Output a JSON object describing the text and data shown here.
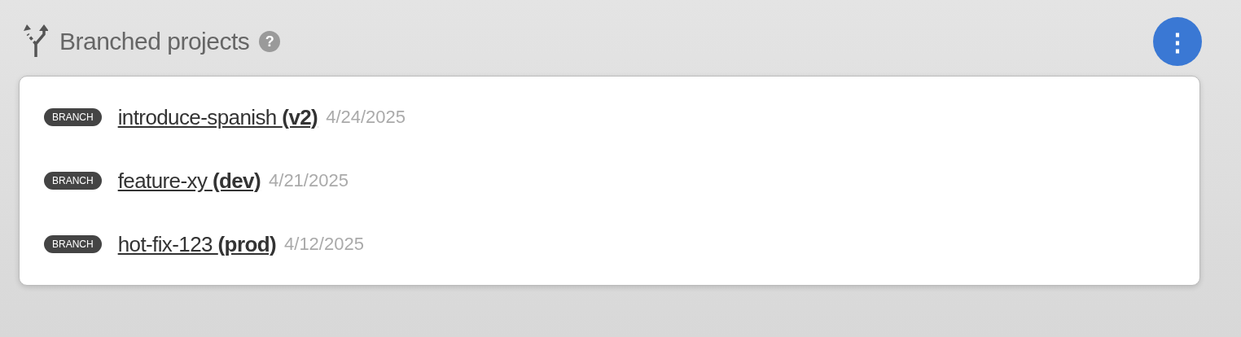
{
  "header": {
    "title": "Branched projects",
    "help": "?"
  },
  "menu_button": {
    "label": "⋮"
  },
  "branches": [
    {
      "tag": "BRANCH",
      "name": "introduce-spanish **(v2)**",
      "date": "4/24/2025"
    },
    {
      "tag": "BRANCH",
      "name": "feature-xy **(dev)**",
      "date": "4/21/2025"
    },
    {
      "tag": "BRANCH",
      "name": "hot-fix-123 **(prod)**",
      "date": "4/12/2025"
    }
  ]
}
